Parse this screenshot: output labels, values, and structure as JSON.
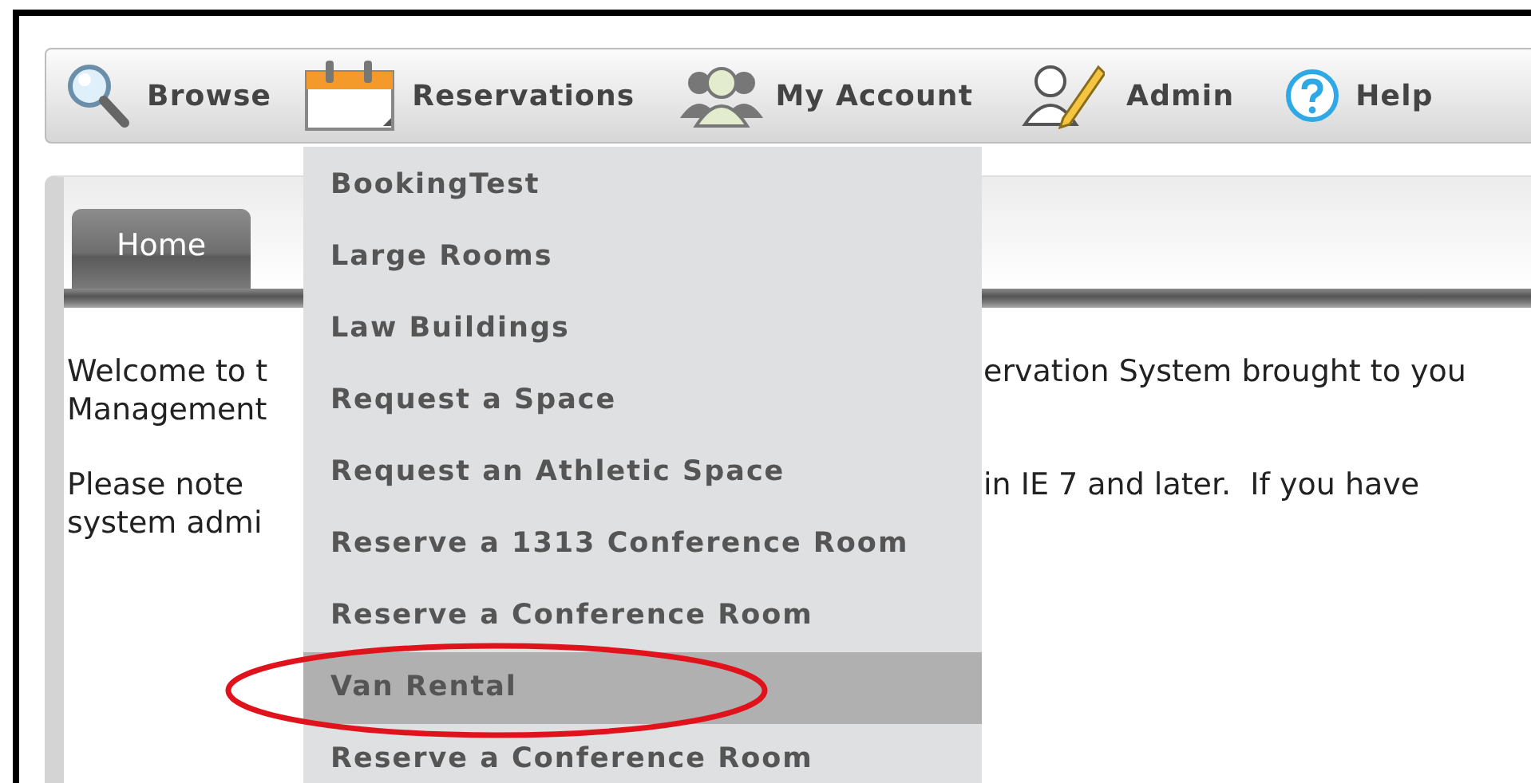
{
  "toolbar": [
    {
      "label": "Browse",
      "kind": "search"
    },
    {
      "label": "Reservations",
      "kind": "calendar"
    },
    {
      "label": "My Account",
      "kind": "people"
    },
    {
      "label": "Admin",
      "kind": "admin"
    },
    {
      "label": "Help",
      "kind": "help"
    }
  ],
  "tabs": [
    {
      "label": "Home"
    }
  ],
  "content": {
    "left_lines": [
      "Welcome to t",
      "Management",
      "Please note",
      "system admi"
    ],
    "right_lines": [
      "ervation System brought to you",
      "in IE 7 and later.  If you have"
    ]
  },
  "menu": [
    {
      "label": "BookingTest",
      "selected": false
    },
    {
      "label": "Large Rooms",
      "selected": false
    },
    {
      "label": "Law Buildings",
      "selected": false
    },
    {
      "label": "Request a Space",
      "selected": false
    },
    {
      "label": "Request an Athletic Space",
      "selected": false
    },
    {
      "label": "Reserve a 1313 Conference Room",
      "selected": false
    },
    {
      "label": "Reserve a Conference Room",
      "selected": false
    },
    {
      "label": "Van Rental",
      "selected": true
    },
    {
      "label": "Reserve a Conference Room",
      "selected": false
    }
  ]
}
